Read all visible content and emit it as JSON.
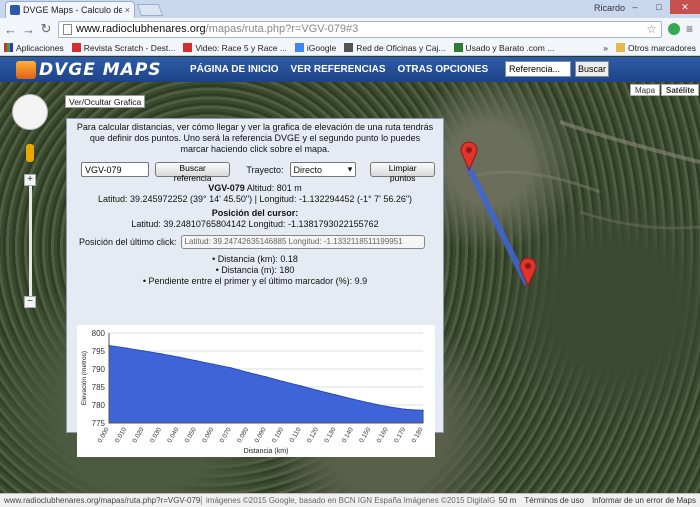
{
  "browser": {
    "tab_title": "DVGE Maps - Calculo de ruta",
    "tab_close": "×",
    "profile": "Ricardo",
    "win_min": "–",
    "win_max": "□",
    "win_close": "✕",
    "url_host": "www.radioclubhenares.org",
    "url_path": "/mapas/ruta.php?r=VGV-079#3",
    "back_icon": "←",
    "forward_icon": "→",
    "reload_icon": "↻",
    "star_icon": "☆",
    "menu_icon": "≡"
  },
  "bookmarks": {
    "apps": "Aplicaciones",
    "items": [
      {
        "label": "Revista Scratch - Dest...",
        "color": "#d32f2f"
      },
      {
        "label": "Video: Race 5 y Race ...",
        "color": "#d32f2f"
      },
      {
        "label": "iGoogle",
        "color": "#4285f4"
      },
      {
        "label": "Red de Oficinas y Caj...",
        "color": "#555555"
      },
      {
        "label": "Usado y Barato .com ...",
        "color": "#2e7d32"
      }
    ],
    "more": "»",
    "others": "Otros marcadores"
  },
  "site": {
    "logo": "DVGE MAPS",
    "nav": [
      "PÁGINA DE INICIO",
      "VER REFERENCIAS",
      "OTRAS OPCIONES"
    ],
    "search_value": "Referencia...",
    "search_button": "Buscar"
  },
  "map": {
    "type_map": "Mapa",
    "type_satellite": "Satélite",
    "toggle_graph": "Ver/Ocultar Grafica",
    "zoom_in": "+",
    "zoom_out": "−"
  },
  "panel": {
    "intro": "Para calcular distancias, ver cómo llegar y ver la grafica de elevación de una ruta tendrás que definir dos puntos. Uno será la referencia DVGE y el segundo punto lo puedes marcar haciendo click sobre el mapa.",
    "ref_value": "VGV-079",
    "search_ref_button": "Buscar referencia",
    "trayecto_label": "Trayecto:",
    "trayecto_value": "Directo",
    "clear_button": "Limpiar puntos",
    "ref_name": "VGV-079",
    "altitude": "Altitud: 801 m",
    "coords_line": "Latitud: 39.245972252 (39° 14' 45.50\") | Longitud: -1.132294452 (-1° 7' 56.26\")",
    "cursor_title": "Posición del cursor:",
    "cursor_coords": "Latitud: 39.24810765804142 Longitud: -1.1381793022155762",
    "last_click_label": "Posición del último click:",
    "last_click_value": "Latitud: 39.24742635146885 Longitud: -1.1332118511199951",
    "stats": [
      "• Distancia (km): 0.18",
      "• Distancia (m): 180",
      "• Pendiente entre el primer y el último marcador (%): 9.9"
    ]
  },
  "chart_data": {
    "type": "area",
    "title": "",
    "xlabel": "Distancia (km)",
    "ylabel": "Elevación (metros)",
    "ylim": [
      775,
      800
    ],
    "xlim": [
      0,
      0.18
    ],
    "yticks": [
      775,
      780,
      785,
      790,
      795,
      800
    ],
    "xtick_labels": [
      "0.000",
      "0.010",
      "0.020",
      "0.030",
      "0.040",
      "0.050",
      "0.060",
      "0.070",
      "0.080",
      "0.090",
      "0.100",
      "0.110",
      "0.120",
      "0.130",
      "0.140",
      "0.150",
      "0.160",
      "0.170",
      "0.180"
    ],
    "series": [
      {
        "color": "#3f64d8",
        "x": [
          0,
          0.01,
          0.02,
          0.03,
          0.04,
          0.05,
          0.06,
          0.07,
          0.08,
          0.09,
          0.1,
          0.11,
          0.12,
          0.13,
          0.14,
          0.15,
          0.16,
          0.17,
          0.18
        ],
        "values": [
          796.5,
          795.8,
          795.0,
          794.2,
          793.3,
          792.3,
          791.3,
          790.3,
          789.0,
          787.8,
          786.5,
          785.3,
          784.0,
          782.8,
          781.6,
          780.5,
          779.5,
          778.8,
          778.5
        ]
      }
    ]
  },
  "statusbar": {
    "url": "www.radioclubhenares.org/mapas/ruta.php?r=VGV-079#3",
    "attribution": "imágenes ©2015 Google, basado en BCN IGN España Imágenes ©2015 DigitalGlobe",
    "scale": "50 m",
    "terms": "Términos de uso",
    "report": "Informar de un error de Maps"
  }
}
